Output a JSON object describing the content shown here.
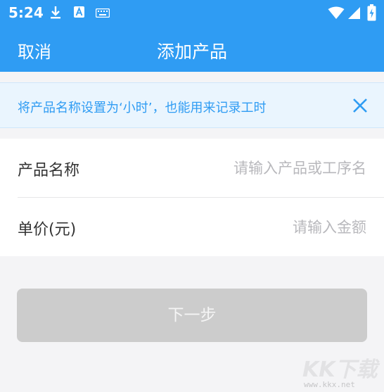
{
  "status_bar": {
    "time": "5:24",
    "icons": [
      "download-icon",
      "a-icon",
      "keyboard-icon",
      "wifi-icon",
      "signal-icon",
      "battery-charging-icon"
    ]
  },
  "nav": {
    "cancel_label": "取消",
    "title": "添加产品"
  },
  "notice": {
    "text": "将产品名称设置为‘小时’，也能用来记录工时",
    "close_icon": "close-icon",
    "color": "#2f9cf3",
    "background": "#eaf5fe"
  },
  "form": {
    "rows": [
      {
        "label": "产品名称",
        "placeholder": "请输入产品或工序名",
        "value": ""
      },
      {
        "label": "单价(元)",
        "placeholder": "请输入金额",
        "value": ""
      }
    ]
  },
  "next_button": {
    "label": "下一步",
    "state": "disabled",
    "color": "#cccccc"
  },
  "watermark": {
    "logo_text": "KK下载",
    "url": "www.kkx.net"
  },
  "colors": {
    "primary": "#2f9cf3",
    "page_background": "#f4f4f6"
  }
}
